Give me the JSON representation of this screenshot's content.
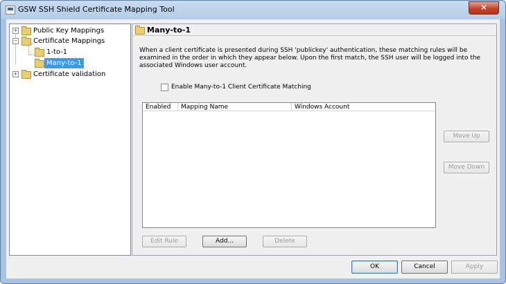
{
  "window": {
    "title": "GSW SSH Shield Certificate Mapping Tool",
    "close_label": "✕"
  },
  "tree": {
    "items": [
      {
        "label": "Public Key Mappings",
        "expander": "+"
      },
      {
        "label": "Certificate Mappings",
        "expander": "−"
      },
      {
        "label": "1-to-1"
      },
      {
        "label": "Many-to-1"
      },
      {
        "label": "Certificate validation",
        "expander": "+"
      }
    ]
  },
  "panel": {
    "title": "Many-to-1",
    "description": "When a client certificate is presented during SSH 'publickey' authentication, these matching rules will be examined in the order in which they appear below. Upon the first match, the SSH user will be logged into the associated Windows user account.",
    "enable_label": "Enable Many-to-1 Client Certificate Matching",
    "columns": [
      "Enabled",
      "Mapping Name",
      "Windows Account"
    ],
    "buttons": {
      "move_up": "Move Up",
      "move_down": "Move Down",
      "edit": "Edit Rule",
      "add": "Add...",
      "delete": "Delete"
    }
  },
  "footer": {
    "ok": "OK",
    "cancel": "Cancel",
    "apply": "Apply"
  }
}
